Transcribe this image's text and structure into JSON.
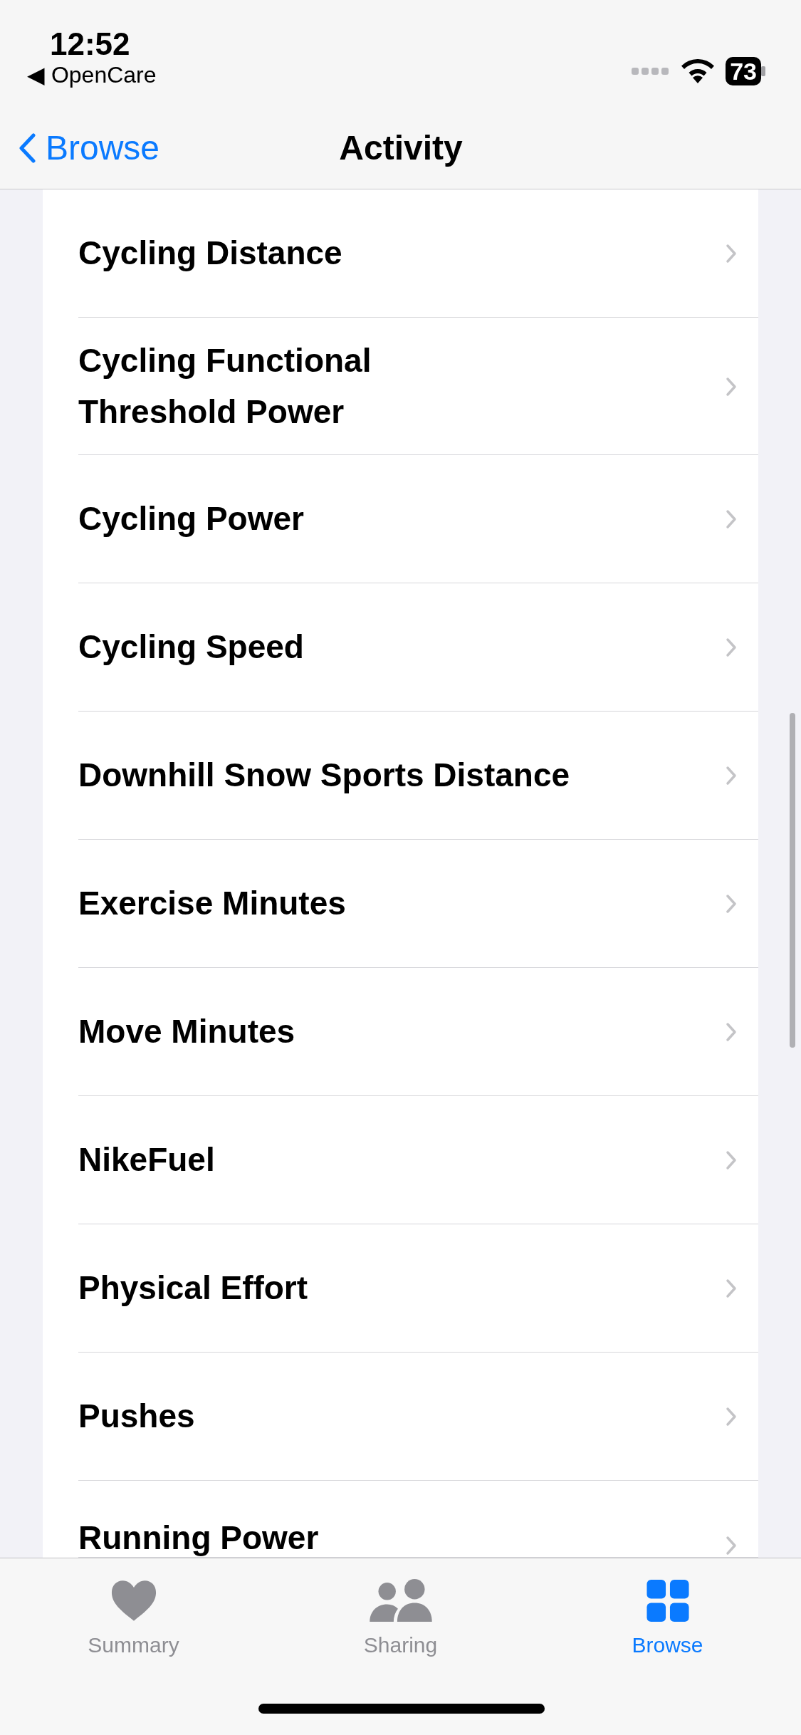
{
  "status_bar": {
    "time": "12:52",
    "back_app": "◀ OpenCare",
    "battery": "73"
  },
  "nav": {
    "back_label": "Browse",
    "title": "Activity"
  },
  "items": [
    {
      "label": "Cycling Distance"
    },
    {
      "label": "Cycling Functional Threshold Power"
    },
    {
      "label": "Cycling Power"
    },
    {
      "label": "Cycling Speed"
    },
    {
      "label": "Downhill Snow Sports Distance"
    },
    {
      "label": "Exercise Minutes"
    },
    {
      "label": "Move Minutes"
    },
    {
      "label": "NikeFuel"
    },
    {
      "label": "Physical Effort"
    },
    {
      "label": "Pushes"
    },
    {
      "label": "Running Power"
    }
  ],
  "tabs": [
    {
      "label": "Summary",
      "kind": "heart",
      "selected": false
    },
    {
      "label": "Sharing",
      "kind": "people",
      "selected": false
    },
    {
      "label": "Browse",
      "kind": "grid",
      "selected": true
    }
  ]
}
